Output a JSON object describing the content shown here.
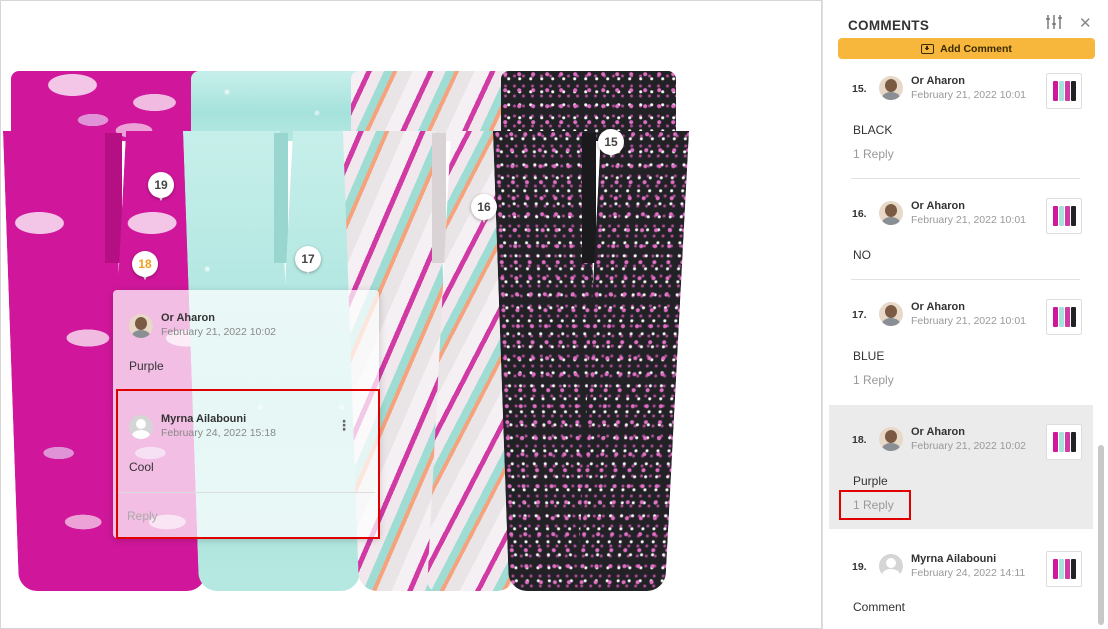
{
  "pins": [
    {
      "label": "19"
    },
    {
      "label": "18"
    },
    {
      "label": "17"
    },
    {
      "label": "16"
    },
    {
      "label": "15"
    }
  ],
  "popup": {
    "comment": {
      "author": "Or Aharon",
      "date": "February 21, 2022 10:02",
      "text": "Purple"
    },
    "reply": {
      "author": "Myrna Ailabouni",
      "date": "February 24, 2022 15:18",
      "text": "Cool"
    },
    "reply_label": "Reply",
    "more_icon": "kebab-icon"
  },
  "sidebar": {
    "title": "COMMENTS",
    "add_label": "Add Comment",
    "colors": {
      "accent": "#f6b73c",
      "highlight": "#e00000"
    },
    "comments": [
      {
        "num": "15.",
        "author": "Or Aharon",
        "date": "February 21, 2022 10:01",
        "text": "BLACK",
        "reply": "1 Reply"
      },
      {
        "num": "16.",
        "author": "Or Aharon",
        "date": "February 21, 2022 10:01",
        "text": "NO"
      },
      {
        "num": "17.",
        "author": "Or Aharon",
        "date": "February 21, 2022 10:01",
        "text": "BLUE",
        "reply": "1 Reply"
      },
      {
        "num": "18.",
        "author": "Or Aharon",
        "date": "February 21, 2022 10:02",
        "text": "Purple",
        "reply": "1 Reply"
      },
      {
        "num": "19.",
        "author": "Myrna Ailabouni",
        "date": "February 24, 2022 14:11",
        "text": "Comment"
      }
    ]
  }
}
